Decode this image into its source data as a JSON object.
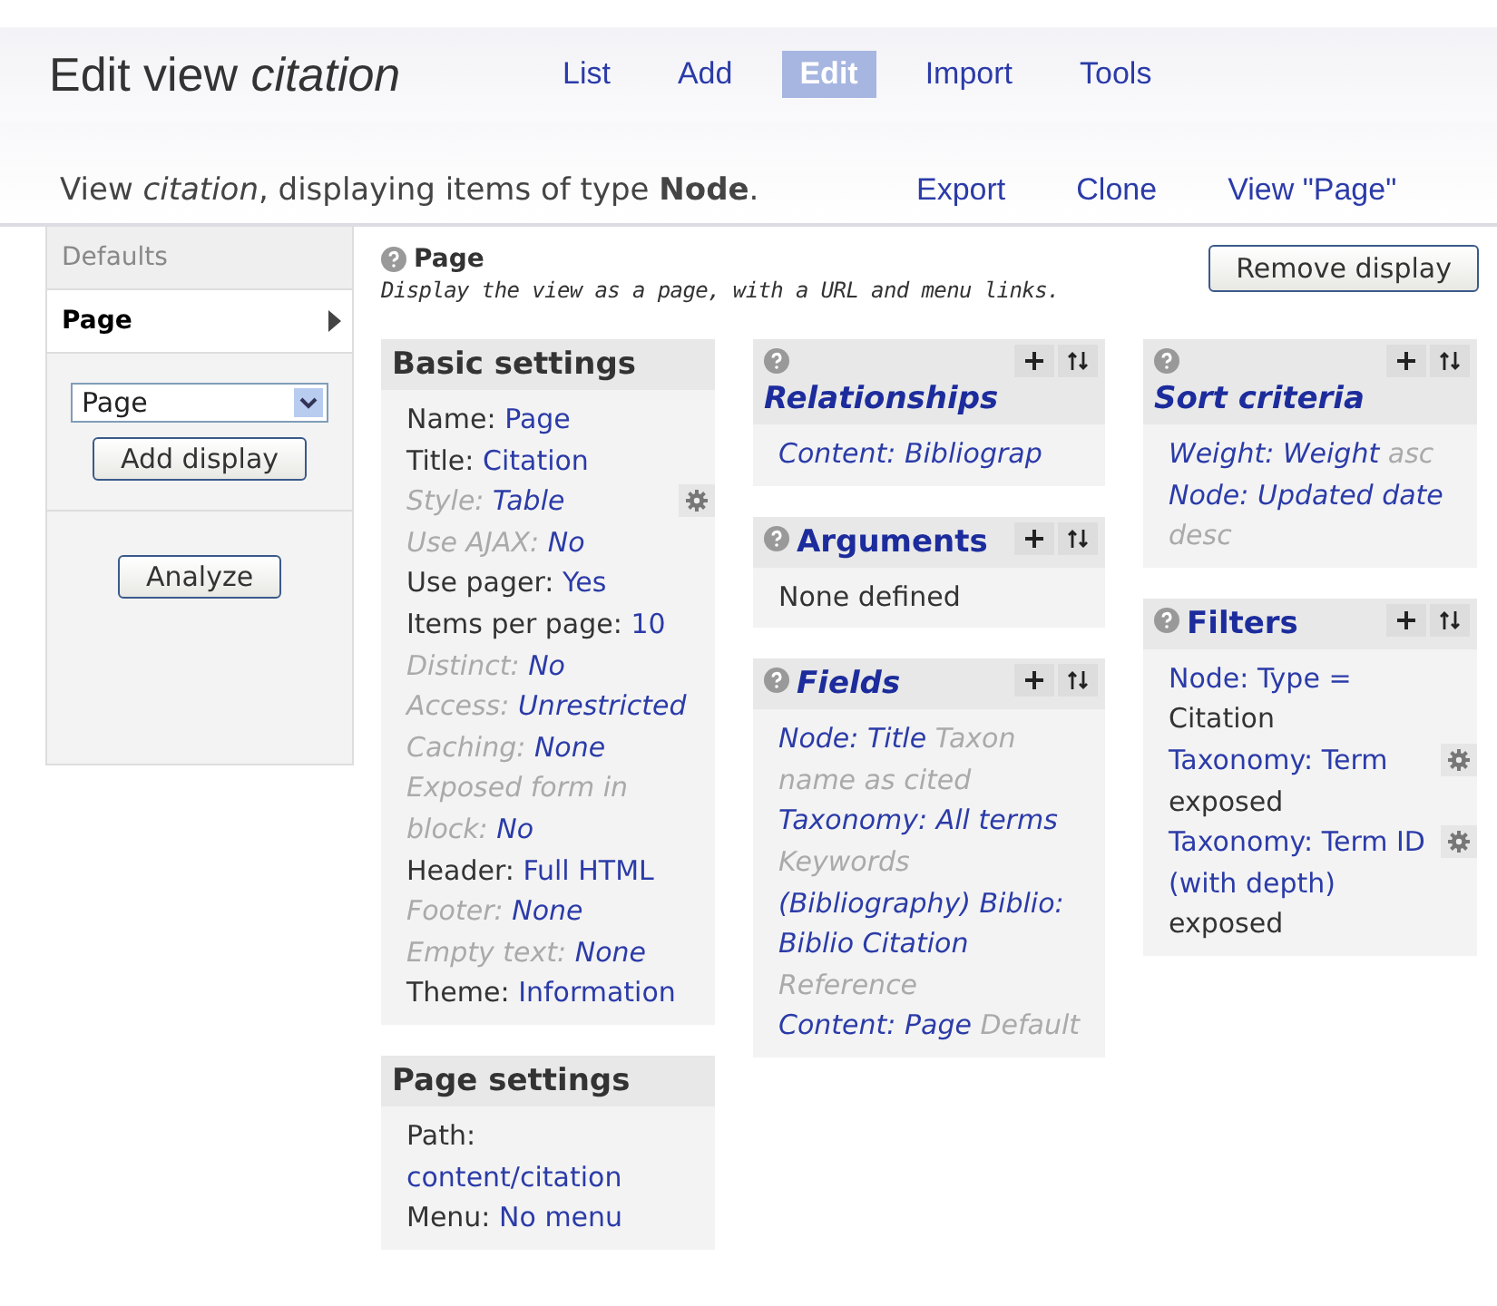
{
  "header": {
    "title": "Edit view *citation*",
    "tabs": [
      {
        "label": "List",
        "selected": false
      },
      {
        "label": "Add",
        "selected": false
      },
      {
        "label": "Edit",
        "selected": true
      },
      {
        "label": "Import",
        "selected": false
      },
      {
        "label": "Tools",
        "selected": false
      }
    ]
  },
  "info": {
    "text": "View *citation*, displaying items of type **Node**.",
    "links": [
      "Export",
      "Clone",
      "View \"Page\""
    ]
  },
  "displays": {
    "items": [
      {
        "label": "Defaults",
        "selected": false
      },
      {
        "label": "Page",
        "selected": true
      }
    ],
    "select_value": "Page",
    "add_button": "Add display",
    "analyze_button": "Analyze"
  },
  "display": {
    "title": "Page",
    "description": "Display the view as a page, with a URL and menu links.",
    "remove_button": "Remove display"
  },
  "columns": [
    [
      {
        "kind": "settings",
        "title": "Basic settings",
        "inherited": false,
        "items": [
          {
            "label": "Name:",
            "value": "Page",
            "inherited": false,
            "gear": false
          },
          {
            "label": "Title:",
            "value": "Citation",
            "inherited": false,
            "gear": false
          },
          {
            "label": "Style:",
            "value": "Table",
            "inherited": true,
            "gear": true
          },
          {
            "label": "Use AJAX:",
            "value": "No",
            "inherited": true,
            "gear": false
          },
          {
            "label": "Use pager:",
            "value": "Yes",
            "inherited": false,
            "gear": false
          },
          {
            "label": "Items per page:",
            "value": "10",
            "inherited": false,
            "gear": false
          },
          {
            "label": "Distinct:",
            "value": "No",
            "inherited": true,
            "gear": false
          },
          {
            "label": "Access:",
            "value": "Unrestricted",
            "inherited": true,
            "gear": false
          },
          {
            "label": "Caching:",
            "value": "None",
            "inherited": true,
            "gear": false
          },
          {
            "label": "Exposed form in block:",
            "value": "No",
            "inherited": true,
            "gear": false
          },
          {
            "label": "Header:",
            "value": "Full HTML",
            "inherited": false,
            "gear": false
          },
          {
            "label": "Footer:",
            "value": "None",
            "inherited": true,
            "gear": false
          },
          {
            "label": "Empty text:",
            "value": "None",
            "inherited": true,
            "gear": false
          },
          {
            "label": "Theme:",
            "value": "Information",
            "inherited": false,
            "gear": false
          }
        ]
      },
      {
        "kind": "settings",
        "title": "Page settings",
        "inherited": false,
        "items": [
          {
            "label": "Path:",
            "value": "content/citation",
            "inherited": false,
            "gear": false
          },
          {
            "label": "Menu:",
            "value": "No menu",
            "inherited": false,
            "gear": false
          }
        ]
      }
    ],
    [
      {
        "kind": "handlers",
        "title": "Relationships",
        "inherited": true,
        "items": [
          {
            "value": "Content: Bibliograp",
            "gear": false
          }
        ]
      },
      {
        "kind": "handlers",
        "title": "Arguments",
        "inherited": false,
        "empty_text": "None defined"
      },
      {
        "kind": "handlers",
        "title": "Fields",
        "inherited": true,
        "items": [
          {
            "value": "Node: Title",
            "note": "Taxon name as cited",
            "gear": false
          },
          {
            "value": "Taxonomy: All terms",
            "note": "Keywords",
            "gear": false
          },
          {
            "value": "(Bibliography) Biblio: Biblio Citation",
            "note": "Reference",
            "gear": false
          },
          {
            "value": "Content: Page",
            "note": "Default",
            "gear": false
          }
        ]
      }
    ],
    [
      {
        "kind": "handlers",
        "title": "Sort criteria",
        "inherited": true,
        "items": [
          {
            "value": "Weight: Weight",
            "note": "asc",
            "gear": false
          },
          {
            "value": "Node: Updated date",
            "note": "desc",
            "gear": false
          }
        ]
      },
      {
        "kind": "handlers",
        "title": "Filters",
        "inherited": false,
        "items": [
          {
            "value": "Node: Type =",
            "note": "Citation",
            "gear": false
          },
          {
            "value": "Taxonomy: Term",
            "note": "exposed",
            "gear": true
          },
          {
            "value": "Taxonomy: Term ID (with depth)",
            "note": "exposed",
            "gear": true
          }
        ]
      }
    ]
  ]
}
